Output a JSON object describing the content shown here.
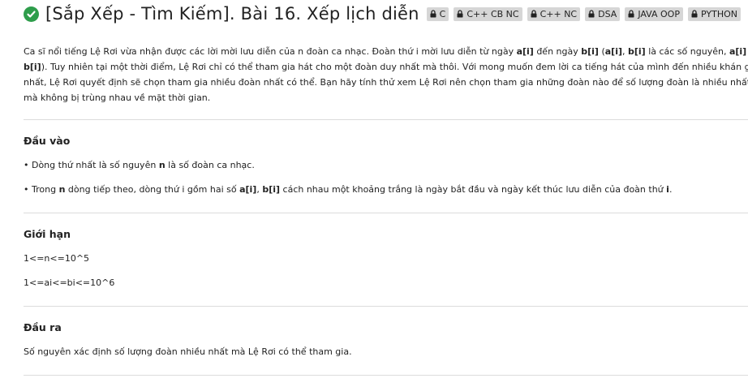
{
  "problem": {
    "title": "[Sắp Xếp - Tìm Kiếm]. Bài 16. Xếp lịch diễn",
    "tags": [
      "C",
      "C++ CB NC",
      "C++ NC",
      "DSA",
      "JAVA OOP",
      "PYTHON"
    ]
  },
  "description": {
    "s1": "Ca sĩ nổi tiếng Lệ Rơi vừa nhận được các lời mời lưu diễn của n đoàn ca nhạc. Đoàn thứ i mời lưu diễn từ ngày ",
    "ai": "a[i]",
    "s2": " đến ngày ",
    "bi": "b[i]",
    "s3": " (",
    "ai2": "a[i]",
    "s4": ", ",
    "bi2": "b[i]",
    "s5": " là các số nguyên, ",
    "ai3": "a[i]",
    "s6": " ≤ ",
    "bi3": "b[i]",
    "s7": "). Tuy nhiên tại một thời điểm, Lệ Rơi chỉ có thể tham gia hát cho một đoàn duy nhất mà thôi. Với mong muốn đem lời ca tiếng hát của mình đến nhiều khán giả nhất, Lệ Rơi quyết định sẽ chọn tham gia nhiều đoàn nhất có thể. Bạn hãy tính thử xem Lệ Rơi nên chọn tham gia những đoàn nào để số lượng đoàn là nhiều nhất mà không bị trùng nhau về mặt thời gian."
  },
  "input": {
    "heading": "Đầu vào",
    "l1a": "• Dòng thứ nhất là số nguyên ",
    "l1n": "n",
    "l1b": " là số đoàn ca nhạc.",
    "l2a": "• Trong ",
    "l2n": "n",
    "l2b": " dòng tiếp theo, dòng thứ i gồm hai số ",
    "l2ai": "a[i]",
    "l2c": ", ",
    "l2bi": "b[i]",
    "l2d": " cách nhau một khoảng trắng là ngày bắt đầu và ngày kết thúc lưu diễn của đoàn thứ ",
    "l2i": "i",
    "l2e": "."
  },
  "limits": {
    "heading": "Giới hạn",
    "l1": "1<=n<=10^5",
    "l2": "1<=ai<=bi<=10^6"
  },
  "output": {
    "heading": "Đầu ra",
    "text": "Số nguyên xác định số lượng đoàn nhiều nhất mà Lệ Rơi có thể tham gia."
  }
}
